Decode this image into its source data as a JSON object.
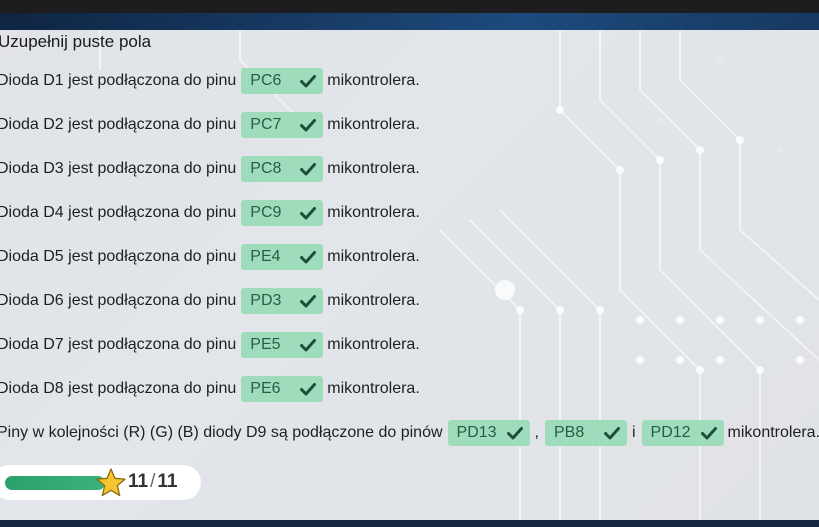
{
  "title": "Uzupełnij puste pola",
  "suffix": "mikontrolera.",
  "rows": [
    {
      "prefix": "Dioda D1 jest podłączona do pinu",
      "answer": "PC6"
    },
    {
      "prefix": "Dioda D2 jest podłączona do pinu",
      "answer": "PC7"
    },
    {
      "prefix": "Dioda D3 jest podłączona do pinu",
      "answer": "PC8"
    },
    {
      "prefix": "Dioda D4 jest podłączona do pinu",
      "answer": "PC9"
    },
    {
      "prefix": "Dioda D5 jest podłączona do pinu",
      "answer": "PE4"
    },
    {
      "prefix": "Dioda D6 jest podłączona do pinu",
      "answer": "PD3"
    },
    {
      "prefix": "Dioda D7 jest podłączona do pinu",
      "answer": "PE5"
    },
    {
      "prefix": "Dioda D8 jest podłączona do pinu",
      "answer": "PE6"
    }
  ],
  "rgb_row": {
    "prefix": "Piny w kolejności (R) (G) (B) diody D9 są podłączone do pinów",
    "answers": [
      "PD13",
      "PB8",
      "PD12"
    ],
    "sep1": ",",
    "sep2": "i",
    "suffix": "mikontrolera."
  },
  "progress": {
    "fraction": 1.0,
    "score": "11",
    "slash": "/",
    "total": "11"
  },
  "icons": {
    "answer_status": "check-icon",
    "progress": "star-icon"
  },
  "colors": {
    "answer_bg": "#9fdcbc",
    "answer_text": "#2c5b45",
    "progress_fill": "#2aa06a",
    "star": "#f7c531"
  }
}
